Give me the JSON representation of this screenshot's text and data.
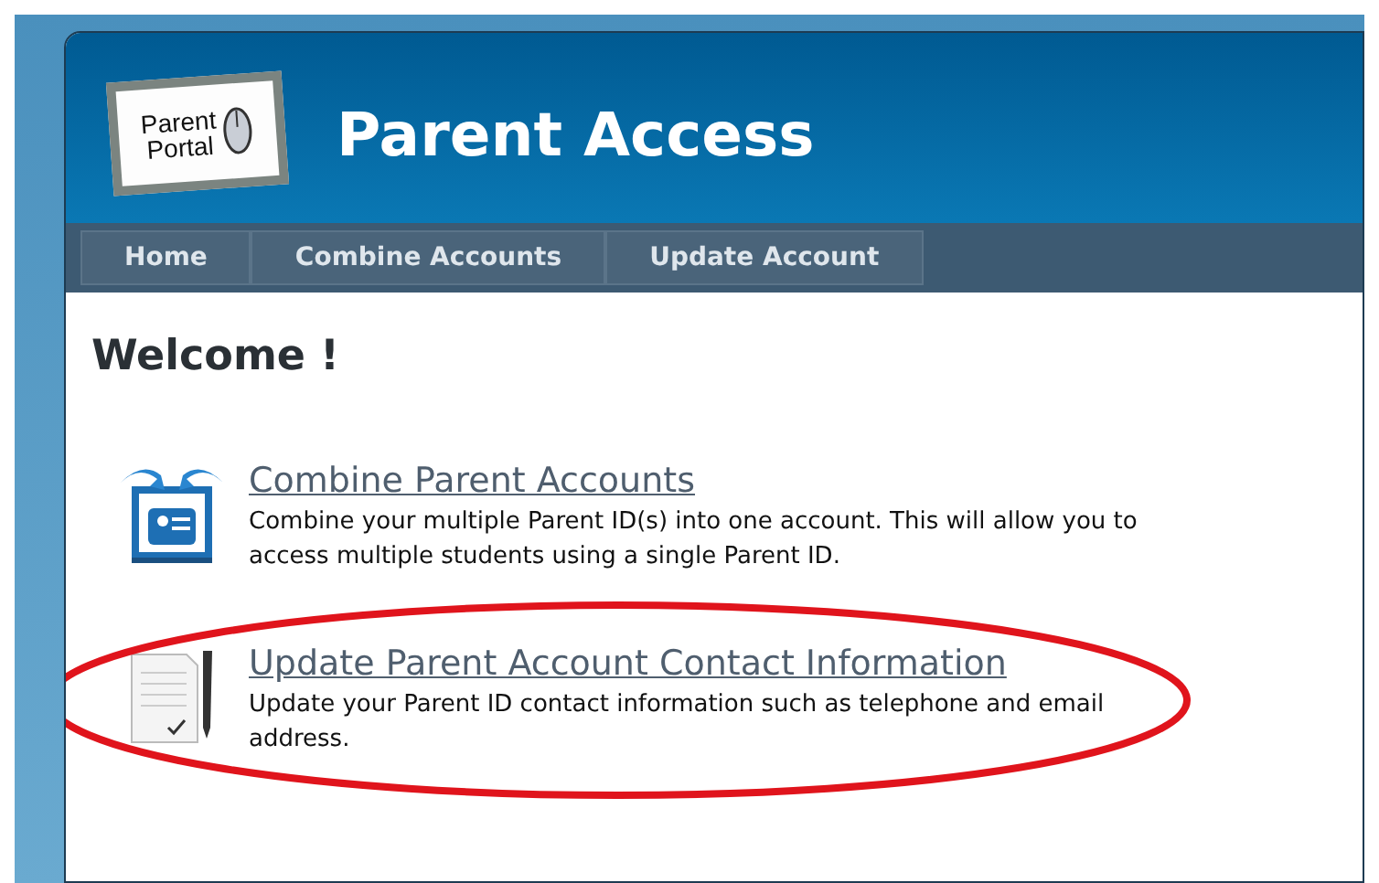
{
  "header": {
    "logo_text": [
      "Parent",
      "Portal"
    ],
    "title": "Parent Access"
  },
  "nav": [
    {
      "label": "Home"
    },
    {
      "label": "Combine Accounts"
    },
    {
      "label": "Update Account"
    }
  ],
  "heading": "Welcome !",
  "options": [
    {
      "kind": "combine",
      "title": "Combine Parent Accounts",
      "description": "Combine your multiple Parent ID(s) into one account. This will allow you to access multiple students using a single Parent ID.",
      "circled": false
    },
    {
      "kind": "update",
      "title": "Update Parent Account Contact Information",
      "description": "Update your Parent ID contact information such as telephone and email address.",
      "circled": true
    }
  ]
}
